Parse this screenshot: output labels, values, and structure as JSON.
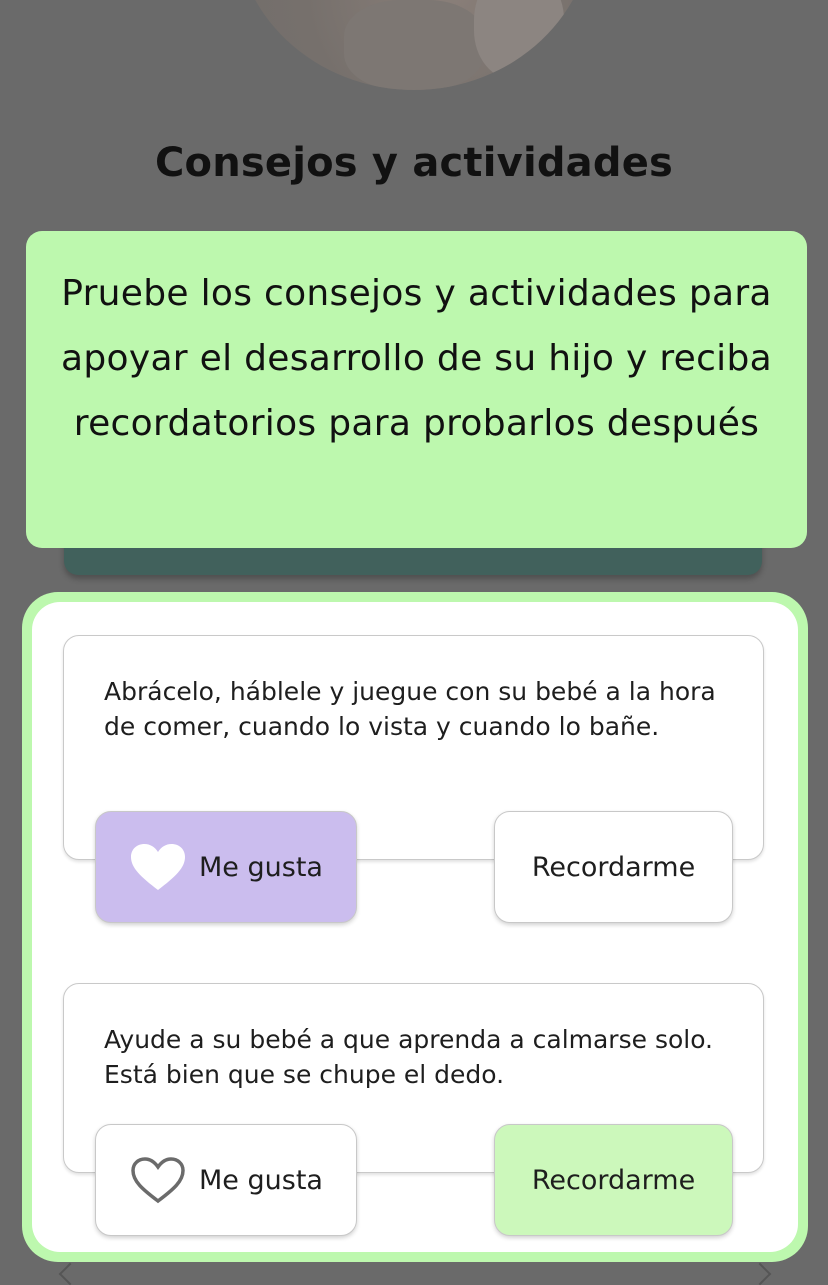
{
  "background": {
    "section_title": "Consejos y actividades"
  },
  "tooltip": {
    "text": "Pruebe los consejos y actividades para apoyar el desarrollo de su hijo y reciba recordatorios para probarlos después"
  },
  "tips": [
    {
      "text": "Abrácelo, háblele y juegue con su bebé a la hora de comer, cuando lo vista y cuando lo bañe.",
      "like_label": "Me gusta",
      "like_icon": "heart-filled-icon",
      "liked": true,
      "remind_label": "Recordarme",
      "reminded": false
    },
    {
      "text": "Ayude a su bebé a que aprenda a calmarse solo. Está bien que se chupe el dedo.",
      "like_label": "Me gusta",
      "like_icon": "heart-outline-icon",
      "liked": false,
      "remind_label": "Recordarme",
      "reminded": true
    }
  ],
  "colors": {
    "overlay": "#6a6a6a",
    "tooltip_bg": "#bdf8ae",
    "liked_bg": "#cbbdee",
    "reminded_bg": "#ccf8bb",
    "teal_card": "#41615c"
  }
}
